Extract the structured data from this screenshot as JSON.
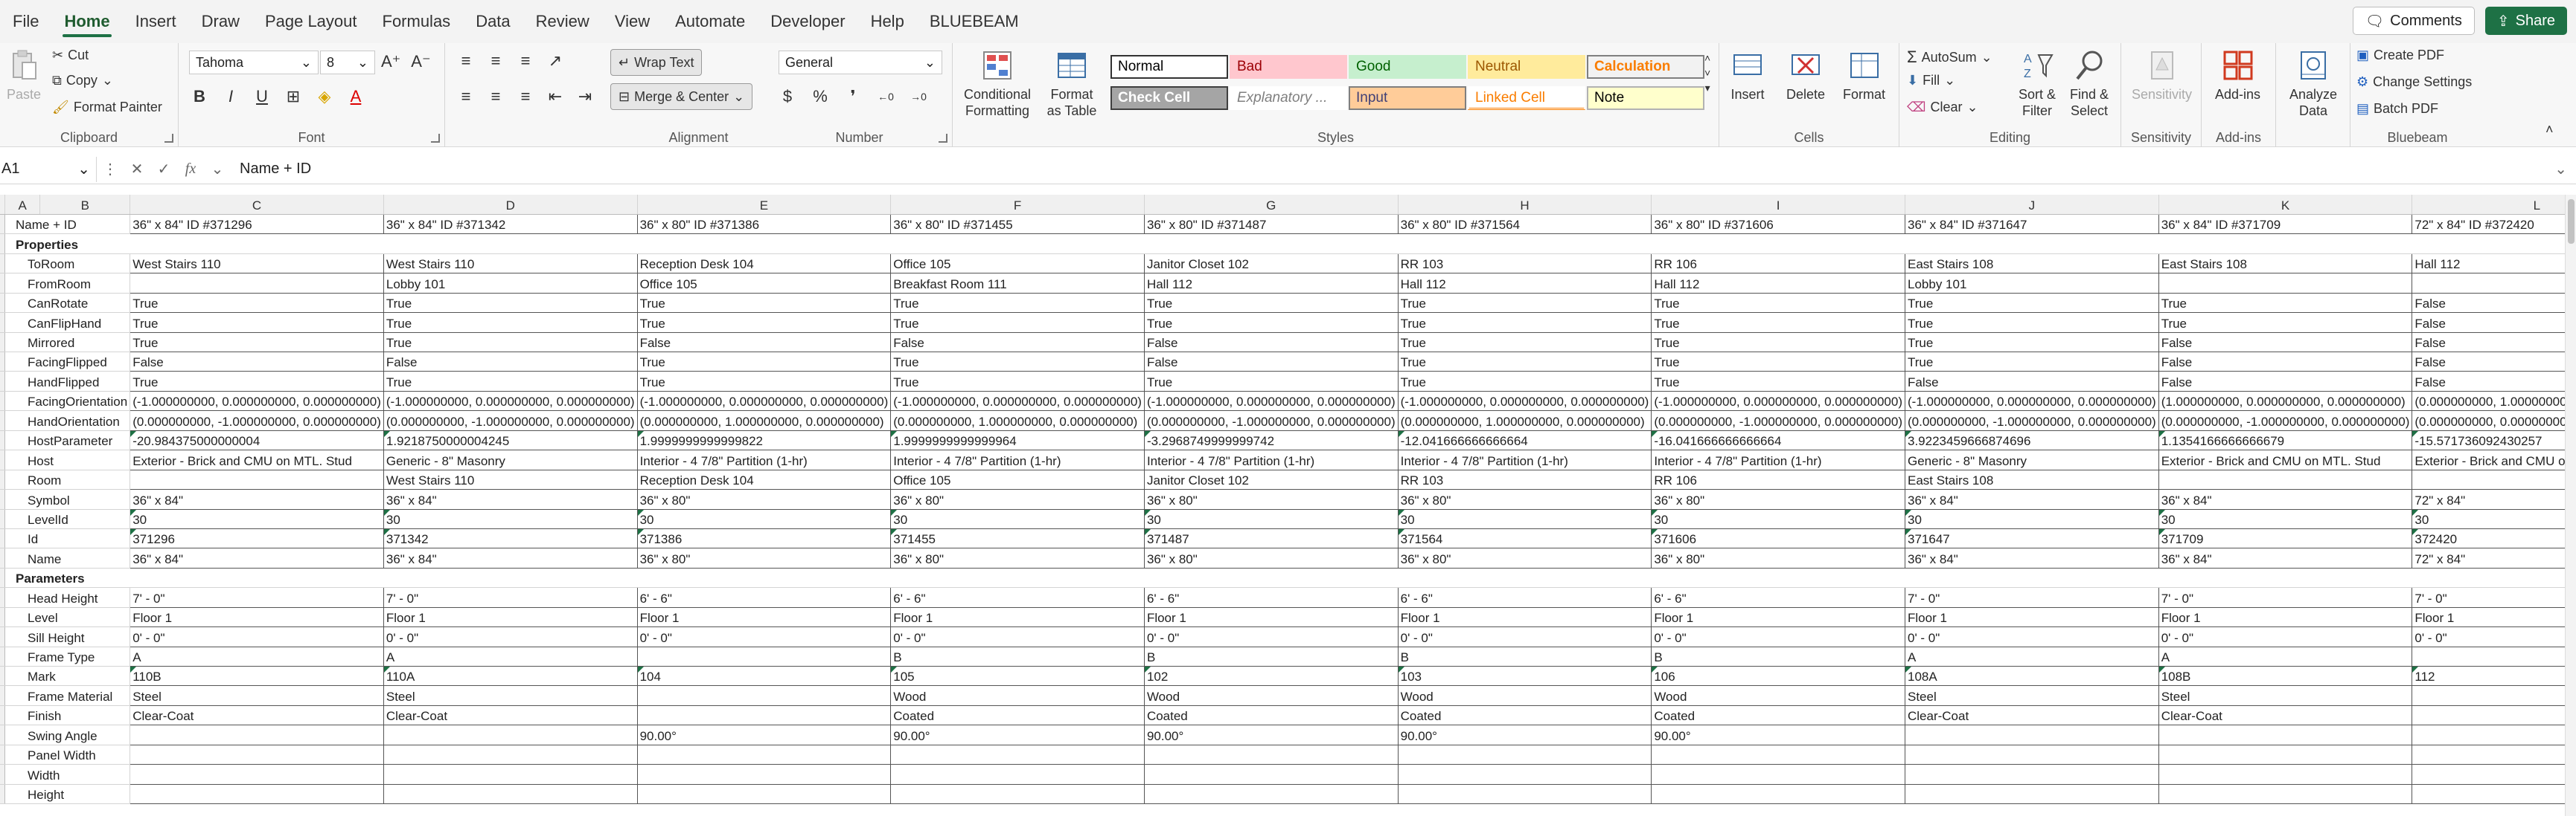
{
  "menu": {
    "tabs": [
      "File",
      "Home",
      "Insert",
      "Draw",
      "Page Layout",
      "Formulas",
      "Data",
      "Review",
      "View",
      "Automate",
      "Developer",
      "Help",
      "BLUEBEAM"
    ],
    "active": "Home",
    "comments_label": "Comments",
    "share_label": "Share"
  },
  "ribbon": {
    "clipboard": {
      "paste": "Paste",
      "cut": "Cut",
      "copy": "Copy",
      "format_painter": "Format Painter",
      "label": "Clipboard"
    },
    "font": {
      "name": "Tahoma",
      "size": "8",
      "label": "Font"
    },
    "alignment": {
      "wrap_text": "Wrap Text",
      "merge_center": "Merge & Center",
      "label": "Alignment"
    },
    "number": {
      "format": "General",
      "label": "Number"
    },
    "styles": {
      "conditional": "Conditional Formatting",
      "format_table": "Format as Table",
      "cells": [
        {
          "label": "Normal",
          "bg": "#ffffff",
          "fg": "#000000",
          "border": "#333333"
        },
        {
          "label": "Bad",
          "bg": "#ffc7ce",
          "fg": "#9c0006",
          "border": "#ffc7ce"
        },
        {
          "label": "Good",
          "bg": "#c6efce",
          "fg": "#006100",
          "border": "#c6efce"
        },
        {
          "label": "Neutral",
          "bg": "#ffeb9c",
          "fg": "#9c5700",
          "border": "#ffeb9c"
        },
        {
          "label": "Calculation",
          "bg": "#f2f2f2",
          "fg": "#fa7d00",
          "border": "#7f7f7f"
        },
        {
          "label": "Check Cell",
          "bg": "#a5a5a5",
          "fg": "#ffffff",
          "border": "#3f3f3f"
        },
        {
          "label": "Explanatory ...",
          "bg": "#ffffff",
          "fg": "#7f7f7f",
          "border": "#ffffff"
        },
        {
          "label": "Input",
          "bg": "#ffcc99",
          "fg": "#3f3f76",
          "border": "#7f7f7f"
        },
        {
          "label": "Linked Cell",
          "bg": "#ffffff",
          "fg": "#fa7d00",
          "border": "#ffffff"
        },
        {
          "label": "Note",
          "bg": "#ffffcc",
          "fg": "#000000",
          "border": "#b2b2b2"
        }
      ],
      "label": "Styles"
    },
    "cells": {
      "insert": "Insert",
      "delete": "Delete",
      "format": "Format",
      "label": "Cells"
    },
    "editing": {
      "autosum": "AutoSum",
      "fill": "Fill",
      "clear": "Clear",
      "sort_filter": "Sort & Filter",
      "find_select": "Find & Select",
      "label": "Editing"
    },
    "sensitivity": {
      "button": "Sensitivity",
      "label": "Sensitivity"
    },
    "addins": {
      "button": "Add-ins",
      "label": "Add-ins"
    },
    "analyze": {
      "button": "Analyze Data"
    },
    "bluebeam": {
      "create_pdf": "Create PDF",
      "change_settings": "Change Settings",
      "batch_pdf": "Batch PDF",
      "label": "Bluebeam"
    }
  },
  "formula_bar": {
    "cell_ref": "A1",
    "content": "Name + ID"
  },
  "sheet": {
    "columns": [
      "A",
      "B",
      "C",
      "D",
      "E",
      "F",
      "G",
      "H",
      "I",
      "J",
      "K",
      "L"
    ],
    "row_numbers": [
      "",
      "",
      "",
      "",
      "",
      "",
      "",
      "",
      "",
      "",
      "",
      "",
      "",
      "",
      "",
      "",
      "",
      "",
      "",
      "",
      "",
      "",
      "",
      "",
      "",
      "",
      "",
      "",
      "",
      "",
      "",
      ""
    ],
    "header_row": {
      "label": "Name + ID",
      "values": [
        "36\" x 84\" ID #371296",
        "36\" x 84\" ID #371342",
        "36\" x 80\" ID #371386",
        "36\" x 80\" ID #371455",
        "36\" x 80\" ID #371487",
        "36\" x 80\" ID #371564",
        "36\" x 80\" ID #371606",
        "36\" x 84\" ID #371647",
        "36\" x 84\" ID #371709",
        "72\" x 84\" ID #372420"
      ]
    },
    "rows": [
      {
        "section": "Properties"
      },
      {
        "label": "ToRoom",
        "values": [
          "West Stairs 110",
          "West Stairs 110",
          "Reception Desk 104",
          "Office 105",
          "Janitor Closet 102",
          "RR 103",
          "RR 106",
          "East Stairs 108",
          "East Stairs 108",
          "Hall 112"
        ]
      },
      {
        "label": "FromRoom",
        "values": [
          "",
          "Lobby 101",
          "Office 105",
          "Breakfast Room 111",
          "Hall 112",
          "Hall 112",
          "Hall 112",
          "Lobby 101",
          "",
          ""
        ]
      },
      {
        "label": "CanRotate",
        "values": [
          "True",
          "True",
          "True",
          "True",
          "True",
          "True",
          "True",
          "True",
          "True",
          "False"
        ]
      },
      {
        "label": "CanFlipHand",
        "values": [
          "True",
          "True",
          "True",
          "True",
          "True",
          "True",
          "True",
          "True",
          "True",
          "False"
        ]
      },
      {
        "label": "Mirrored",
        "values": [
          "True",
          "True",
          "False",
          "False",
          "False",
          "True",
          "True",
          "True",
          "False",
          "False"
        ]
      },
      {
        "label": "FacingFlipped",
        "values": [
          "False",
          "False",
          "True",
          "True",
          "False",
          "True",
          "True",
          "True",
          "False",
          "False"
        ]
      },
      {
        "label": "HandFlipped",
        "values": [
          "True",
          "True",
          "True",
          "True",
          "True",
          "True",
          "True",
          "False",
          "False",
          "False"
        ]
      },
      {
        "label": "FacingOrientation",
        "values": [
          "(-1.000000000, 0.000000000, 0.000000000)",
          "(-1.000000000, 0.000000000, 0.000000000)",
          "(-1.000000000, 0.000000000, 0.000000000)",
          "(-1.000000000, 0.000000000, 0.000000000)",
          "(-1.000000000, 0.000000000, 0.000000000)",
          "(-1.000000000, 0.000000000, 0.000000000)",
          "(-1.000000000, 0.000000000, 0.000000000)",
          "(-1.000000000, 0.000000000, 0.000000000)",
          "(1.000000000, 0.000000000, 0.000000000)",
          "(0.000000000, 1.000000000, 0.000000000)"
        ]
      },
      {
        "label": "HandOrientation",
        "values": [
          "(0.000000000, -1.000000000, 0.000000000)",
          "(0.000000000, -1.000000000, 0.000000000)",
          "(0.000000000, 1.000000000, 0.000000000)",
          "(0.000000000, 1.000000000, 0.000000000)",
          "(0.000000000, -1.000000000, 0.000000000)",
          "(0.000000000, 1.000000000, 0.000000000)",
          "(0.000000000, -1.000000000, 0.000000000)",
          "(0.000000000, -1.000000000, 0.000000000)",
          "(0.000000000, -1.000000000, 0.000000000)",
          "(0.000000000, 0.000000000, 0.000000000)"
        ]
      },
      {
        "label": "HostParameter",
        "values": [
          "-20.984375000000004",
          "1.9218750000004245",
          "1.9999999999999822",
          "1.9999999999999964",
          "-3.2968749999999742",
          "-12.041666666666664",
          "-16.041666666666664",
          "3.9223459666874696",
          "1.1354166666666679",
          "-15.571736092430257"
        ],
        "flag": true
      },
      {
        "label": "Host",
        "values": [
          "Exterior - Brick and CMU on MTL. Stud",
          "Generic - 8\" Masonry",
          "Interior - 4 7/8\" Partition (1-hr)",
          "Interior - 4 7/8\" Partition (1-hr)",
          "Interior - 4 7/8\" Partition (1-hr)",
          "Interior - 4 7/8\" Partition (1-hr)",
          "Interior - 4 7/8\" Partition (1-hr)",
          "Generic - 8\" Masonry",
          "Exterior - Brick and CMU on MTL. Stud",
          "Exterior - Brick and CMU on MTL. Stud"
        ]
      },
      {
        "label": "Room",
        "values": [
          "",
          "West Stairs 110",
          "Reception Desk 104",
          "Office 105",
          "Janitor Closet 102",
          "RR 103",
          "RR 106",
          "East Stairs 108",
          "",
          ""
        ]
      },
      {
        "label": "Symbol",
        "values": [
          "36\" x 84\"",
          "36\" x 84\"",
          "36\" x 80\"",
          "36\" x 80\"",
          "36\" x 80\"",
          "36\" x 80\"",
          "36\" x 80\"",
          "36\" x 84\"",
          "36\" x 84\"",
          "72\" x 84\""
        ]
      },
      {
        "label": "LevelId",
        "values": [
          "30",
          "30",
          "30",
          "30",
          "30",
          "30",
          "30",
          "30",
          "30",
          "30"
        ],
        "flag": true
      },
      {
        "label": "Id",
        "values": [
          "371296",
          "371342",
          "371386",
          "371455",
          "371487",
          "371564",
          "371606",
          "371647",
          "371709",
          "372420"
        ],
        "flag": true
      },
      {
        "label": "Name",
        "values": [
          "36\" x 84\"",
          "36\" x 84\"",
          "36\" x 80\"",
          "36\" x 80\"",
          "36\" x 80\"",
          "36\" x 80\"",
          "36\" x 80\"",
          "36\" x 84\"",
          "36\" x 84\"",
          "72\" x 84\""
        ]
      },
      {
        "section": "Parameters"
      },
      {
        "label": "Head Height",
        "values": [
          "7' - 0\"",
          "7' - 0\"",
          "6' - 6\"",
          "6' - 6\"",
          "6' - 6\"",
          "6' - 6\"",
          "6' - 6\"",
          "7' - 0\"",
          "7' - 0\"",
          "7' - 0\""
        ]
      },
      {
        "label": "Level",
        "values": [
          "Floor 1",
          "Floor 1",
          "Floor 1",
          "Floor 1",
          "Floor 1",
          "Floor 1",
          "Floor 1",
          "Floor 1",
          "Floor 1",
          "Floor 1"
        ]
      },
      {
        "label": "Sill Height",
        "values": [
          "0' - 0\"",
          "0' - 0\"",
          "0' - 0\"",
          "0' - 0\"",
          "0' - 0\"",
          "0' - 0\"",
          "0' - 0\"",
          "0' - 0\"",
          "0' - 0\"",
          "0' - 0\""
        ]
      },
      {
        "label": "Frame Type",
        "values": [
          "A",
          "A",
          "",
          "B",
          "B",
          "B",
          "B",
          "A",
          "A",
          ""
        ]
      },
      {
        "label": "Mark",
        "values": [
          "110B",
          "110A",
          "104",
          "105",
          "102",
          "103",
          "106",
          "108A",
          "108B",
          "112"
        ],
        "flag": true
      },
      {
        "label": "Frame Material",
        "values": [
          "Steel",
          "Steel",
          "",
          "Wood",
          "Wood",
          "Wood",
          "Wood",
          "Steel",
          "Steel",
          ""
        ]
      },
      {
        "label": "Finish",
        "values": [
          "Clear-Coat",
          "Clear-Coat",
          "",
          "Coated",
          "Coated",
          "Coated",
          "Coated",
          "Clear-Coat",
          "Clear-Coat",
          ""
        ]
      },
      {
        "label": "Swing Angle",
        "values": [
          "",
          "",
          "90.00°",
          "90.00°",
          "90.00°",
          "90.00°",
          "90.00°",
          "",
          "",
          ""
        ]
      },
      {
        "label": "Panel Width",
        "values": [
          "",
          "",
          "",
          "",
          "",
          "",
          "",
          "",
          "",
          ""
        ]
      },
      {
        "label": "Width",
        "values": [
          "",
          "",
          "",
          "",
          "",
          "",
          "",
          "",
          "",
          ""
        ]
      },
      {
        "label": "Height",
        "values": [
          "",
          "",
          "",
          "",
          "",
          "",
          "",
          "",
          "",
          ""
        ]
      }
    ]
  }
}
